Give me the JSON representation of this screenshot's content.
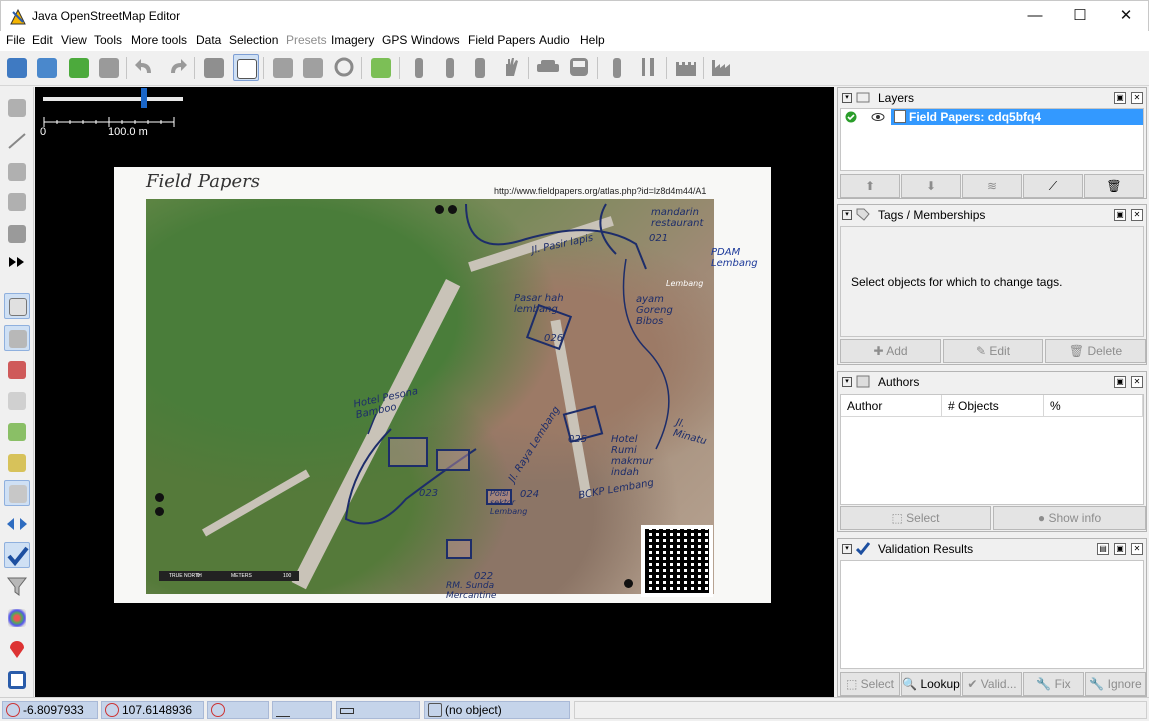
{
  "window": {
    "title": "Java OpenStreetMap Editor",
    "minimize": "—",
    "maximize": "☐",
    "close": "✕"
  },
  "menu": [
    {
      "label": "File"
    },
    {
      "label": "Edit"
    },
    {
      "label": "View"
    },
    {
      "label": "Tools"
    },
    {
      "label": "More tools"
    },
    {
      "label": "Data"
    },
    {
      "label": "Selection"
    },
    {
      "label": "Presets",
      "disabled": true
    },
    {
      "label": "Imagery"
    },
    {
      "label": "GPS"
    },
    {
      "label": "Windows"
    },
    {
      "label": "Field Papers"
    },
    {
      "label": "Audio"
    },
    {
      "label": "Help"
    }
  ],
  "toolbar_icons": [
    "open-icon",
    "download-icon",
    "download-data-icon",
    "upload-icon",
    "undo-icon",
    "redo-icon",
    "preferences-icon",
    "wireframe-icon",
    "split-way-icon",
    "combine-way-icon",
    "refresh-icon",
    "fit-icon",
    "wall-icon",
    "column-icon",
    "barrier-icon",
    "hand-icon",
    "car-icon",
    "bus-icon",
    "poi-icon",
    "restaurant-icon",
    "castle-icon",
    "factory-icon"
  ],
  "map": {
    "scale_zero": "0",
    "scale_label": "100.0 m",
    "fieldpapers": {
      "title": "Field Papers",
      "url": "http://www.fieldpapers.org/atlas.php?id=lz8d4m44/A1",
      "notes": {
        "n_mandarin": "mandarin restaurant",
        "n_021": "021",
        "n_pdam": "PDAM Lembang",
        "n_pasir": "Jl. Pasir lapis",
        "n_lembang_road": "Lembang",
        "n_pasar": "Pasar hah lembang",
        "n_026": "026",
        "n_ayam": "ayam Goreng Bibos",
        "n_hotel": "Hotel Pesona Bamboo",
        "n_025": "025",
        "n_minatu": "Jl. Minatu",
        "n_raya": "Jl. Raya Lembang",
        "n_hotel2": "Hotel Rumi makmur indah",
        "n_023": "023",
        "n_polsi": "Polsi sektor Lembang",
        "n_bckp": "BCKP Lembang",
        "n_022": "022",
        "n_rm": "RM. Sunda Mercantine",
        "n_024": "024"
      },
      "legend": {
        "true_north": "TRUE NORTH",
        "scale_start": "0",
        "scale_units": "METERS",
        "scale_end": "100"
      }
    }
  },
  "layers": {
    "title": "Layers",
    "items": [
      {
        "name": "Field Papers: cdq5bfq4",
        "visible": true,
        "active": true
      }
    ],
    "buttons": [
      "move-up-icon",
      "move-down-icon",
      "merge-icon",
      "activate-icon",
      "delete-icon"
    ]
  },
  "tags": {
    "title": "Tags / Memberships",
    "empty_text": "Select objects for which to change tags.",
    "buttons": {
      "add": "Add",
      "edit": "Edit",
      "delete": "Delete"
    }
  },
  "authors": {
    "title": "Authors",
    "columns": [
      "Author",
      "# Objects",
      "%"
    ],
    "buttons": {
      "select": "Select",
      "show_info": "Show info"
    }
  },
  "validation": {
    "title": "Validation Results",
    "buttons": {
      "select": "Select",
      "lookup": "Lookup",
      "validate": "Valid...",
      "fix": "Fix",
      "ignore": "Ignore"
    }
  },
  "status": {
    "lat": "-6.8097933",
    "lon": "107.6148936",
    "heading": "",
    "angle": "",
    "distance": "",
    "object": "(no object)"
  }
}
